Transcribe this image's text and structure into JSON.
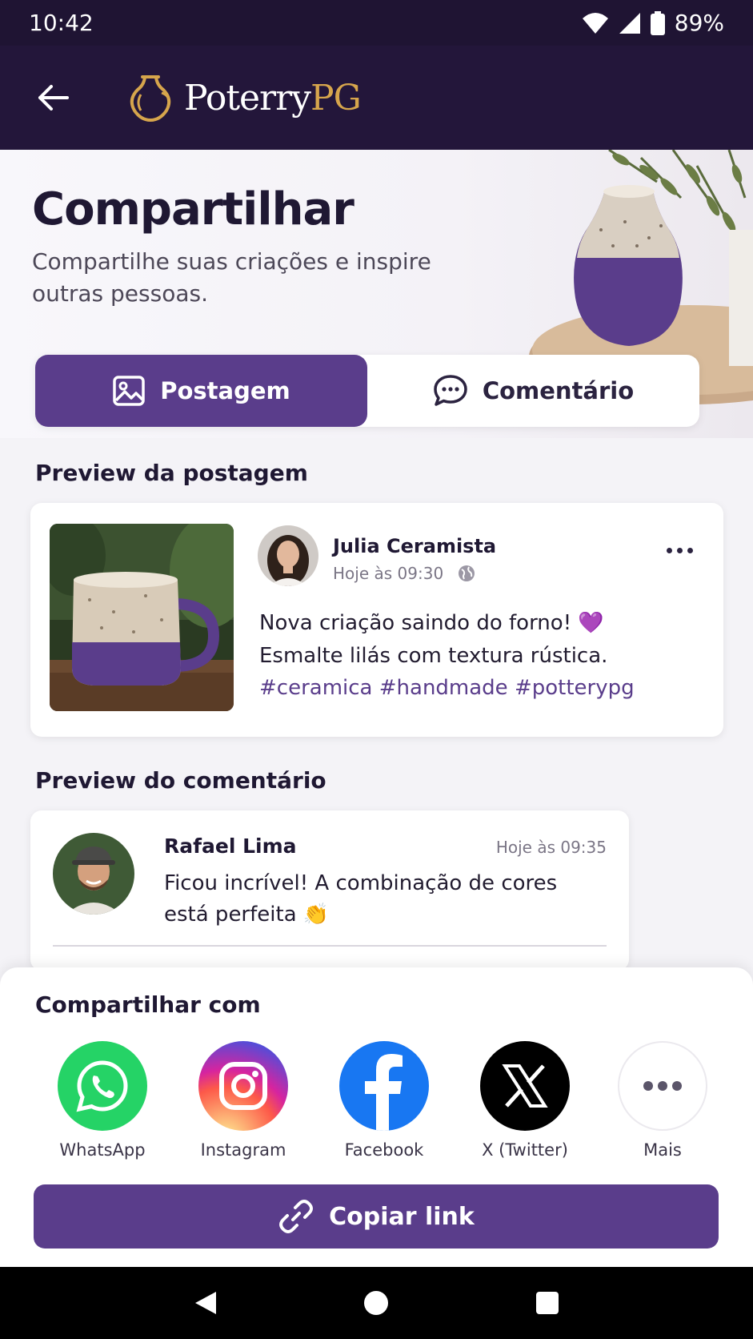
{
  "status_bar": {
    "time": "10:42",
    "battery": "89%"
  },
  "app_bar": {
    "logo_part1": "Poterry",
    "logo_part2": "PG"
  },
  "hero": {
    "title": "Compartilhar",
    "subtitle": "Compartilhe suas criações e inspire outras pessoas."
  },
  "tabs": [
    {
      "label": "Postagem",
      "active": true
    },
    {
      "label": "Comentário",
      "active": false
    }
  ],
  "post_preview": {
    "section_title": "Preview da postagem",
    "author": "Julia Ceramista",
    "time": "Hoje às 09:30",
    "text": "Nova criação saindo do forno! 💜 Esmalte lilás com textura rústica.",
    "hashtags": "#ceramica #handmade #potterypg"
  },
  "comment_preview": {
    "section_title": "Preview do comentário",
    "author": "Rafael Lima",
    "time": "Hoje às 09:35",
    "text": "Ficou incrível! A combinação de cores está perfeita 👏"
  },
  "share": {
    "title": "Compartilhar com",
    "targets": [
      {
        "label": "WhatsApp",
        "icon": "whatsapp-icon",
        "color": "#25d366"
      },
      {
        "label": "Instagram",
        "icon": "instagram-icon",
        "color": "#dd2a7b"
      },
      {
        "label": "Facebook",
        "icon": "facebook-icon",
        "color": "#1877f2"
      },
      {
        "label": "X (Twitter)",
        "icon": "x-icon",
        "color": "#000000"
      },
      {
        "label": "Mais",
        "icon": "more-icon",
        "color": "#ffffff"
      }
    ],
    "copy_link": "Copiar link"
  },
  "colors": {
    "primary": "#5a3d8b",
    "header": "#23163a",
    "accent_gold": "#d6a54c"
  }
}
